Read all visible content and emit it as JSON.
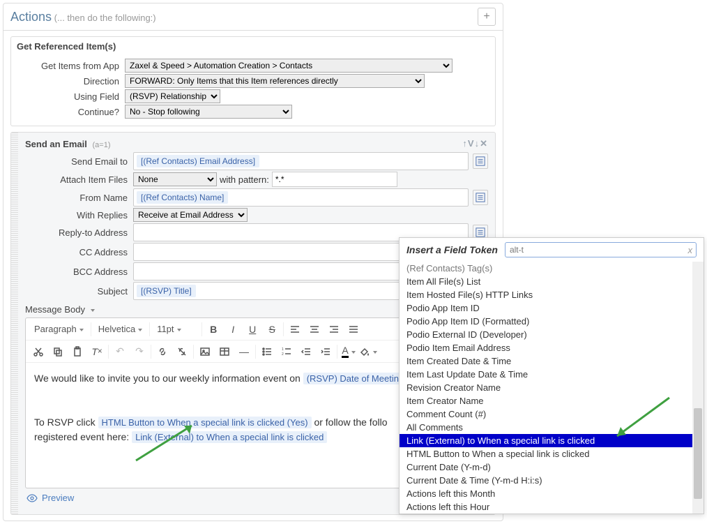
{
  "actions": {
    "title": "Actions",
    "subtitle": "(... then do the following:)",
    "plus": "+"
  },
  "get_ref": {
    "title": "Get Referenced Item(s)",
    "labels": {
      "app": "Get Items from App",
      "direction": "Direction",
      "using_field": "Using Field",
      "continue": "Continue?"
    },
    "values": {
      "app": "Zaxel & Speed > Automation Creation > Contacts",
      "direction": "FORWARD: Only Items that this Item references directly",
      "using_field": "(RSVP) Relationship",
      "continue": "No - Stop following"
    }
  },
  "email": {
    "title": "Send an Email",
    "a1": "(a=1)",
    "icons": "↑V↓✕",
    "labels": {
      "to": "Send Email to",
      "attach": "Attach Item Files",
      "pattern": "with pattern:",
      "from": "From Name",
      "replies": "With Replies",
      "reply_to": "Reply-to Address",
      "cc": "CC Address",
      "bcc": "BCC Address",
      "subject": "Subject",
      "body": "Message Body"
    },
    "values": {
      "to_token": "[(Ref Contacts) Email Address]",
      "attach": "None",
      "pattern": "*.*",
      "from_token": "[(Ref Contacts) Name]",
      "replies": "Receive at Email Address",
      "subject_token": "[(RSVP) Title]"
    },
    "toolbar": {
      "format": "Paragraph",
      "font": "Helvetica",
      "size": "11pt"
    },
    "body": {
      "line1a": "We would like to invite you to our weekly information event on  ",
      "tk1": "(RSVP) Date of Meeting",
      "line2a": "To RSVP click  ",
      "tk2": "HTML Button to When a special link is clicked (Yes)",
      "line2b": "  or follow the follo",
      "line3a": "registered event here:   ",
      "tk3": "Link (External) to When a special link is clicked"
    },
    "preview": "Preview"
  },
  "popup": {
    "title": "Insert a Field Token",
    "search": "alt-t",
    "items": [
      "(Ref Contacts) Tag(s)",
      "Item All File(s) List",
      "Item Hosted File(s) HTTP Links",
      "Podio App Item ID",
      "Podio App Item ID (Formatted)",
      "Podio External ID (Developer)",
      "Podio Item Email Address",
      "Item Created Date & Time",
      "Item Last Update Date & Time",
      "Revision Creator Name",
      "Item Creator Name",
      "Comment Count (#)",
      "All Comments",
      "Link (External) to When a special link is clicked",
      "HTML Button to When a special link is clicked",
      "Current Date (Y-m-d)",
      "Current Date & Time (Y-m-d H:i:s)",
      "Actions left this Month",
      "Actions left this Hour"
    ],
    "selected_index": 13
  }
}
